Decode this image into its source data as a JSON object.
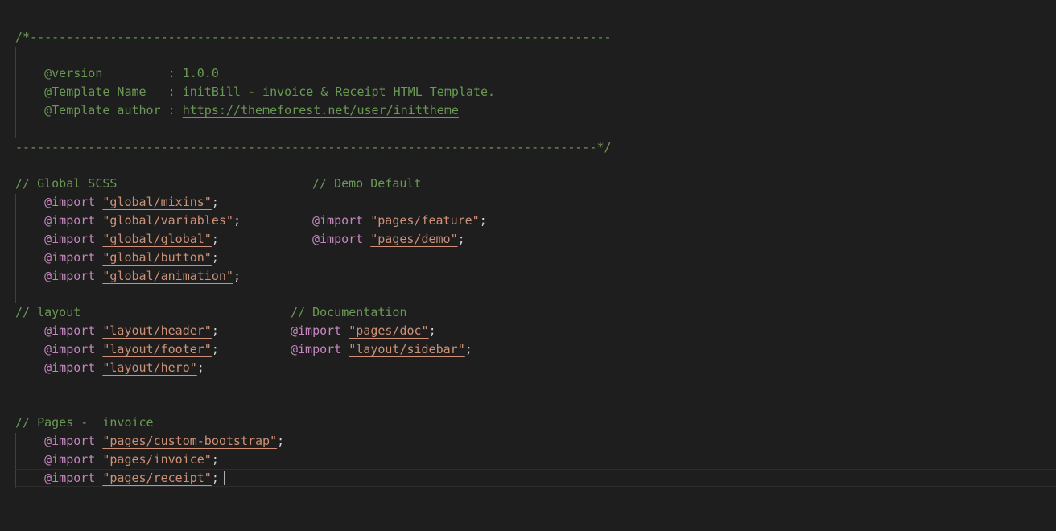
{
  "editor": {
    "header_comment": {
      "open": "/*--------------------------------------------------------------------------------",
      "version_line": "    @version         : 1.0.0",
      "name_line": "    @Template Name   : initBill - invoice & Receipt HTML Template.",
      "author_prefix": "    @Template author : ",
      "author_url": "https://themeforest.net/user/inittheme",
      "close": "--------------------------------------------------------------------------------*/"
    },
    "import_keyword": "@import",
    "semicolon": ";",
    "global_scss": {
      "heading": "// Global SCSS",
      "imports": [
        "\"global/mixins\"",
        "\"global/variables\"",
        "\"global/global\"",
        "\"global/button\"",
        "\"global/animation\""
      ]
    },
    "demo_default": {
      "heading": "// Demo Default",
      "imports": [
        "\"pages/feature\"",
        "\"pages/demo\""
      ]
    },
    "layout": {
      "heading": "// layout",
      "imports": [
        "\"layout/header\"",
        "\"layout/footer\"",
        "\"layout/hero\""
      ]
    },
    "documentation": {
      "heading": "// Documentation",
      "imports": [
        "\"pages/doc\"",
        "\"layout/sidebar\""
      ]
    },
    "pages_invoice": {
      "heading": "// Pages -  invoice",
      "imports": [
        "\"pages/custom-bootstrap\"",
        "\"pages/invoice\"",
        "\"pages/receipt\""
      ]
    }
  },
  "colors": {
    "background": "#1e1e1e",
    "comment": "#6a9955",
    "keyword": "#c586c0",
    "string": "#ce9178",
    "text": "#d4d4d4"
  }
}
